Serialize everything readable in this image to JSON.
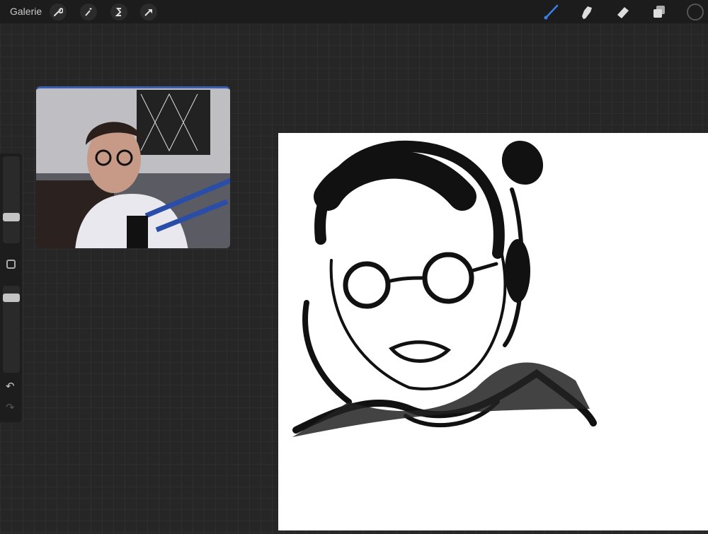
{
  "toolbar": {
    "gallery_label": "Galerie",
    "left_tools": [
      "wrench-icon",
      "magic-wand-icon",
      "selection-s-icon",
      "arrow-transform-icon"
    ],
    "right_tools": [
      "brush-icon",
      "smudge-icon",
      "eraser-icon",
      "layers-icon",
      "color-picker"
    ],
    "active_tool": "brush",
    "accent": "#3a7ee8",
    "current_color": "#1c1c1c"
  },
  "sidebar": {
    "brush_size": 0.28,
    "opacity": 0.9,
    "modify_button": "modify-square-icon",
    "undo": "undo-icon",
    "redo": "redo-icon"
  }
}
